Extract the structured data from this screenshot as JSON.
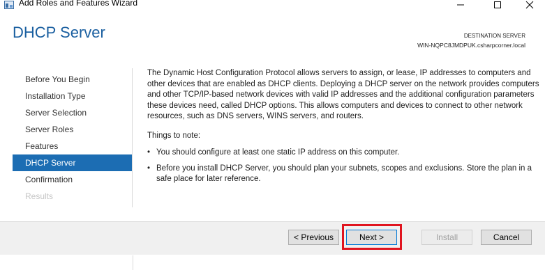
{
  "window": {
    "title": "Add Roles and Features Wizard",
    "icons": {
      "app": "server-manager-icon",
      "minimize": "minimize-icon",
      "maximize": "maximize-icon",
      "close": "close-icon"
    }
  },
  "header": {
    "page_title": "DHCP Server",
    "destination_label": "DESTINATION SERVER",
    "destination_server": "WIN-NQPC8JMDPUK.csharpcorner.local"
  },
  "sidebar": {
    "items": [
      {
        "label": "Before You Begin",
        "state": "normal"
      },
      {
        "label": "Installation Type",
        "state": "normal"
      },
      {
        "label": "Server Selection",
        "state": "normal"
      },
      {
        "label": "Server Roles",
        "state": "normal"
      },
      {
        "label": "Features",
        "state": "normal"
      },
      {
        "label": "DHCP Server",
        "state": "active"
      },
      {
        "label": "Confirmation",
        "state": "normal"
      },
      {
        "label": "Results",
        "state": "disabled"
      }
    ]
  },
  "main": {
    "intro": "The Dynamic Host Configuration Protocol allows servers to assign, or lease, IP addresses to computers and other devices that are enabled as DHCP clients. Deploying a DHCP server on the network provides computers and other TCP/IP-based network devices with valid IP addresses and the additional configuration parameters these devices need, called DHCP options. This allows computers and devices to connect to other network resources, such as DNS servers, WINS servers, and routers.",
    "note_label": "Things to note:",
    "bullet_char": "•",
    "bullets": [
      "You should configure at least one static IP address on this computer.",
      "Before you install DHCP Server, you should plan your subnets, scopes and exclusions. Store the plan in a safe place for later reference."
    ]
  },
  "footer": {
    "previous": "< Previous",
    "next": "Next >",
    "install": "Install",
    "cancel": "Cancel",
    "highlight_color": "#e0141f"
  },
  "colors": {
    "accent": "#1c6db3",
    "title": "#1a5fa0",
    "disabled_text": "#c6c6c6"
  }
}
